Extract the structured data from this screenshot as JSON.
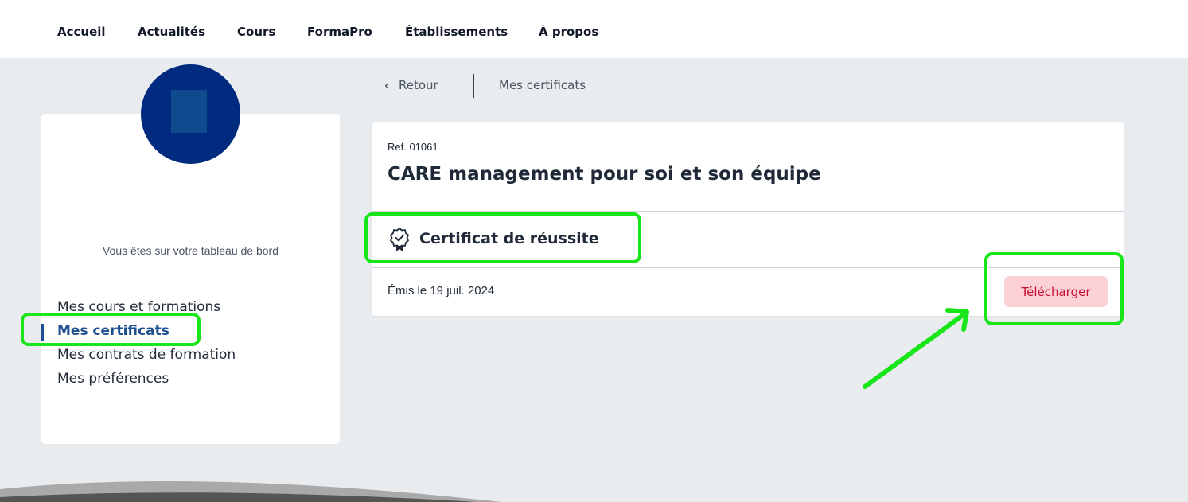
{
  "nav": {
    "items": [
      "Accueil",
      "Actualités",
      "Cours",
      "FormaPro",
      "Établissements",
      "À propos"
    ]
  },
  "sidebar": {
    "dashboard_text": "Vous êtes sur votre tableau de bord",
    "items": [
      {
        "label": "Mes cours et formations",
        "active": false
      },
      {
        "label": "Mes certificats",
        "active": true
      },
      {
        "label": "Mes contrats de formation",
        "active": false
      },
      {
        "label": "Mes préférences",
        "active": false
      }
    ]
  },
  "breadcrumb": {
    "back_label": "Retour",
    "back_icon": "chevron-left-icon",
    "current": "Mes certificats"
  },
  "certificate": {
    "ref": "Ref. 01061",
    "course_title": "CARE management pour soi et son équipe",
    "type_icon": "certificate-badge-icon",
    "type_label": "Certificat de réussite",
    "issued": "Émis le 19 juil. 2024",
    "download_label": "Télécharger"
  },
  "colors": {
    "accent_blue": "#1d4f91",
    "avatar_blue": "#002b7f",
    "button_bg": "#fbd0d6",
    "button_text": "#c8102e",
    "annotation_green": "#19e619"
  }
}
